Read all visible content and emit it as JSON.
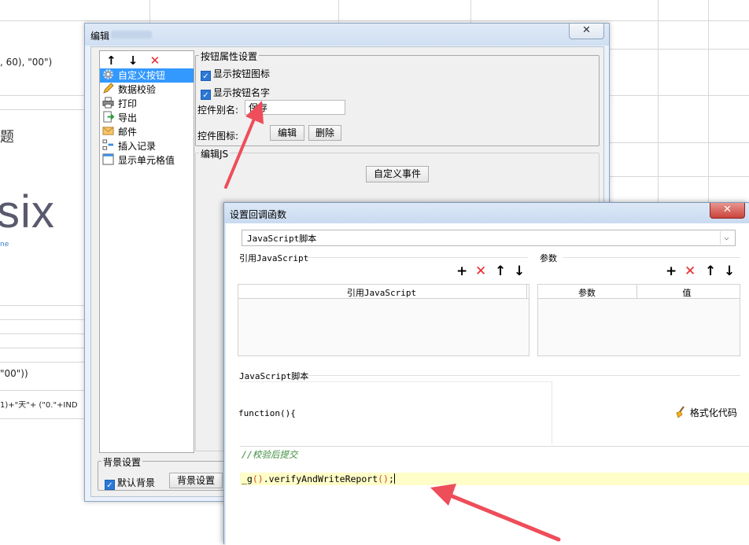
{
  "background": {
    "formula_top": ", 60), \"00\")",
    "title_fragment": "题",
    "big_text": "six",
    "small_text": "ne",
    "formula_mid": "\"00\"))",
    "formula_low": "1)+\"天\"+ (\"0.\"+IND"
  },
  "edit_dialog": {
    "title": "编辑",
    "close_label": "✕",
    "toolbar": {
      "up": "↑",
      "down": "↓",
      "delete": "✕"
    },
    "list_items": [
      {
        "label": "自定义按钮",
        "icon": "gear-icon"
      },
      {
        "label": "数据校验",
        "icon": "pencil-icon"
      },
      {
        "label": "打印",
        "icon": "printer-icon"
      },
      {
        "label": "导出",
        "icon": "export-icon"
      },
      {
        "label": "邮件",
        "icon": "mail-icon"
      },
      {
        "label": "插入记录",
        "icon": "insert-record-icon"
      },
      {
        "label": "显示单元格值",
        "icon": "cell-value-icon"
      }
    ],
    "button_props": {
      "group_title": "按钮属性设置",
      "show_icon_label": "显示按钮图标",
      "show_name_label": "显示按钮名字",
      "alias_label": "控件别名:",
      "alias_value": "保存",
      "icon_label": "控件图标:",
      "edit_button": "编辑",
      "delete_button": "删除"
    },
    "edit_js": {
      "group_title": "编辑JS",
      "custom_event_button": "自定义事件"
    },
    "background_settings": {
      "group_title": "背景设置",
      "default_bg_label": "默认背景",
      "bg_settings_button": "背景设置"
    }
  },
  "callback_dialog": {
    "title": "设置回调函数",
    "close_label": "✕",
    "type_select": "JavaScript脚本",
    "ref_js_section": "引用JavaScript",
    "ref_js_column": "引用JavaScript",
    "params_section": "参数",
    "params_columns": [
      "参数",
      "值"
    ],
    "script_section": "JavaScript脚本",
    "function_signature": "function(){",
    "format_code_button": "格式化代码",
    "code": {
      "comment": "//校验后提交",
      "call_prefix": "_g",
      "call_suffix": ".verifyAndWriteReport",
      "end": ";"
    }
  },
  "colors": {
    "accent_red": "#ee4d5a",
    "selection_blue": "#3399ff",
    "highlight_yellow": "#fffec8"
  }
}
